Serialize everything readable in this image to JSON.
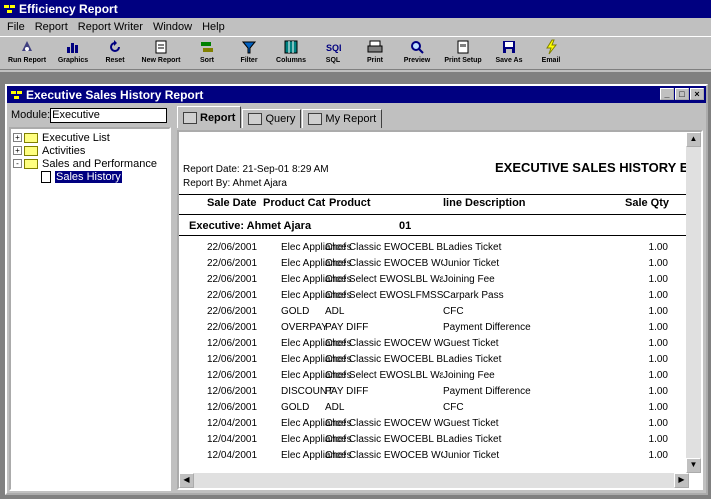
{
  "app": {
    "title": "Efficiency Report"
  },
  "menu": [
    "File",
    "Report",
    "Report Writer",
    "Window",
    "Help"
  ],
  "toolbar": [
    {
      "label": "Run Report",
      "icon": "run-report-icon"
    },
    {
      "label": "Graphics",
      "icon": "graphics-icon"
    },
    {
      "label": "Reset",
      "icon": "reset-icon"
    },
    {
      "label": "New Report",
      "icon": "new-report-icon"
    },
    {
      "label": "Sort",
      "icon": "sort-icon"
    },
    {
      "label": "Filter",
      "icon": "filter-icon"
    },
    {
      "label": "Columns",
      "icon": "columns-icon"
    },
    {
      "label": "SQL",
      "icon": "sql-icon"
    },
    {
      "label": "Print",
      "icon": "print-icon"
    },
    {
      "label": "Preview",
      "icon": "preview-icon"
    },
    {
      "label": "Print Setup",
      "icon": "print-setup-icon"
    },
    {
      "label": "Save As",
      "icon": "save-as-icon"
    },
    {
      "label": "Email",
      "icon": "email-icon"
    }
  ],
  "window": {
    "title": "Executive Sales History Report"
  },
  "module": {
    "label": "Module:",
    "value": "Executive"
  },
  "tree": [
    {
      "label": "Executive List",
      "type": "folder",
      "expander": "+"
    },
    {
      "label": "Activities",
      "type": "folder",
      "expander": "+"
    },
    {
      "label": "Sales and Performance",
      "type": "folder",
      "expander": "-"
    },
    {
      "label": "Sales History",
      "type": "document",
      "selected": true
    }
  ],
  "tabs": [
    {
      "label": "Report",
      "active": true
    },
    {
      "label": "Query",
      "active": false
    },
    {
      "label": "My Report",
      "active": false
    }
  ],
  "report": {
    "title": "EXECUTIVE SALES HISTORY E",
    "date_line": "Report Date:  21-Sep-01 8:29 AM",
    "by_line": "Report By:     Ahmet Ajara",
    "columns": [
      "Sale Date",
      "Product Cat",
      "Product",
      "line Description",
      "Sale Qty"
    ],
    "group_label": "Executive: Ahmet Ajara",
    "group_value": "01",
    "rows": [
      {
        "date": "22/06/2001",
        "cat": "Elec Appliances",
        "product": "Chef Classic EWOCEBL BL",
        "desc": "Ladies Ticket",
        "qty": "1.00"
      },
      {
        "date": "22/06/2001",
        "cat": "Elec Appliances",
        "product": "Chef Classic EWOCEB WO",
        "desc": "Junior Ticket",
        "qty": "1.00"
      },
      {
        "date": "22/06/2001",
        "cat": "Elec Appliances",
        "product": "Chef Select EWOSLBL Wa",
        "desc": "Joining Fee",
        "qty": "1.00"
      },
      {
        "date": "22/06/2001",
        "cat": "Elec Appliances",
        "product": "Chef Select EWOSLFMSS",
        "desc": "Carpark Pass",
        "qty": "1.00"
      },
      {
        "date": "22/06/2001",
        "cat": "GOLD",
        "product": "ADL",
        "desc": "CFC",
        "qty": "1.00"
      },
      {
        "date": "22/06/2001",
        "cat": "OVERPAY",
        "product": "PAY DIFF",
        "desc": "Payment Difference",
        "qty": "1.00"
      },
      {
        "date": "12/06/2001",
        "cat": "Elec Appliances",
        "product": "Chef Classic EWOCEW WH",
        "desc": "Guest Ticket",
        "qty": "1.00"
      },
      {
        "date": "12/06/2001",
        "cat": "Elec Appliances",
        "product": "Chef Classic EWOCEBL BL",
        "desc": "Ladies Ticket",
        "qty": "1.00"
      },
      {
        "date": "12/06/2001",
        "cat": "Elec Appliances",
        "product": "Chef Select EWOSLBL Wa",
        "desc": "Joining Fee",
        "qty": "1.00"
      },
      {
        "date": "12/06/2001",
        "cat": "DISCOUNT",
        "product": "PAY DIFF",
        "desc": "Payment Difference",
        "qty": "1.00"
      },
      {
        "date": "12/06/2001",
        "cat": "GOLD",
        "product": "ADL",
        "desc": "CFC",
        "qty": "1.00"
      },
      {
        "date": "12/04/2001",
        "cat": "Elec Appliances",
        "product": "Chef Classic EWOCEW WH",
        "desc": "Guest Ticket",
        "qty": "1.00"
      },
      {
        "date": "12/04/2001",
        "cat": "Elec Appliances",
        "product": "Chef Classic EWOCEBL BL",
        "desc": "Ladies Ticket",
        "qty": "1.00"
      },
      {
        "date": "12/04/2001",
        "cat": "Elec Appliances",
        "product": "Chef Classic EWOCEB WO",
        "desc": "Junior Ticket",
        "qty": "1.00"
      }
    ]
  },
  "colors": {
    "titlebar": "#000080",
    "face": "#c0c0c0",
    "desktop": "#808080"
  }
}
